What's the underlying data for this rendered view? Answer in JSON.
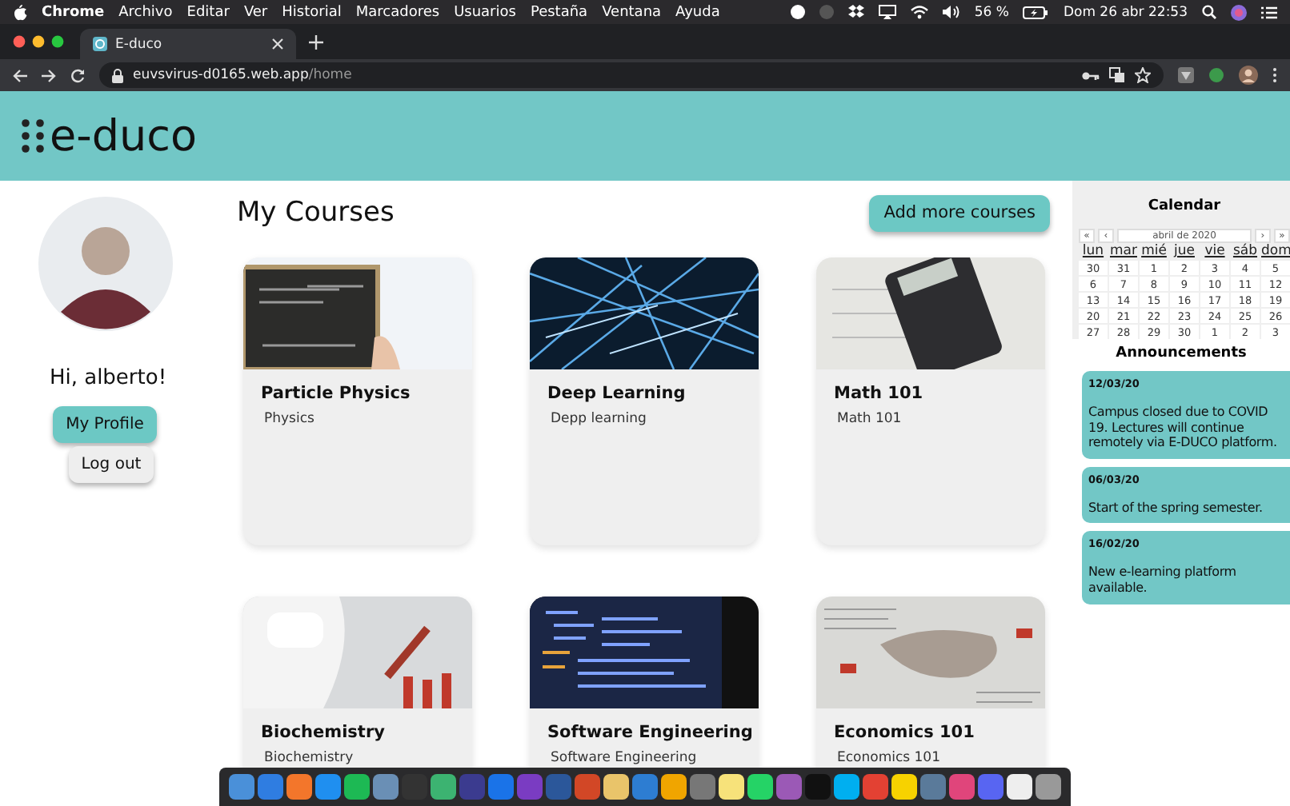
{
  "menu_bar": {
    "app": "Chrome",
    "items": [
      "Archivo",
      "Editar",
      "Ver",
      "Historial",
      "Marcadores",
      "Usuarios",
      "Pestaña",
      "Ventana",
      "Ayuda"
    ],
    "battery": "56 %",
    "clock": "Dom 26 abr  22:53"
  },
  "browser": {
    "tab_title": "E-duco",
    "url_host": "euvsvirus-d0165.web.app",
    "url_path": "/home"
  },
  "header": {
    "logo": "e-duco"
  },
  "sidebar": {
    "greeting": "Hi, alberto!",
    "buttons": [
      {
        "label": "My Profile",
        "kind": "primary"
      },
      {
        "label": "Log out",
        "kind": "secondary"
      }
    ]
  },
  "courses": {
    "title": "My Courses",
    "add_button": "Add more courses",
    "items": [
      {
        "title": "Particle Physics",
        "subtitle": "Physics",
        "kind": "chalkboard"
      },
      {
        "title": "Deep Learning",
        "subtitle": "Depp learning",
        "kind": "network"
      },
      {
        "title": "Math 101",
        "subtitle": "Math 101",
        "kind": "calculator"
      },
      {
        "title": "Biochemistry",
        "subtitle": "Biochemistry",
        "kind": "lab"
      },
      {
        "title": "Software Engineering",
        "subtitle": "Software Engineering",
        "kind": "code"
      },
      {
        "title": "Economics 101",
        "subtitle": "Economics 101",
        "kind": "newspaper"
      }
    ]
  },
  "calendar": {
    "title": "Calendar",
    "nav": [
      "«",
      "‹",
      "abril de 2020",
      "›",
      "»"
    ],
    "weekdays": [
      "lun",
      "mar",
      "mié",
      "jue",
      "vie",
      "sáb",
      "dom"
    ],
    "weeks": [
      [
        "30",
        "31",
        "1",
        "2",
        "3",
        "4",
        "5"
      ],
      [
        "6",
        "7",
        "8",
        "9",
        "10",
        "11",
        "12"
      ],
      [
        "13",
        "14",
        "15",
        "16",
        "17",
        "18",
        "19"
      ],
      [
        "20",
        "21",
        "22",
        "23",
        "24",
        "25",
        "26"
      ],
      [
        "27",
        "28",
        "29",
        "30",
        "1",
        "2",
        "3"
      ]
    ]
  },
  "announcements": {
    "title": "Announcements",
    "items": [
      {
        "date": "12/03/20",
        "text": "Campus closed due to COVID 19. Lectures will continue remotely via E-DUCO platform."
      },
      {
        "date": "06/03/20",
        "text": "Start of the spring semester."
      },
      {
        "date": "16/02/20",
        "text": "New e-learning platform available."
      }
    ]
  }
}
